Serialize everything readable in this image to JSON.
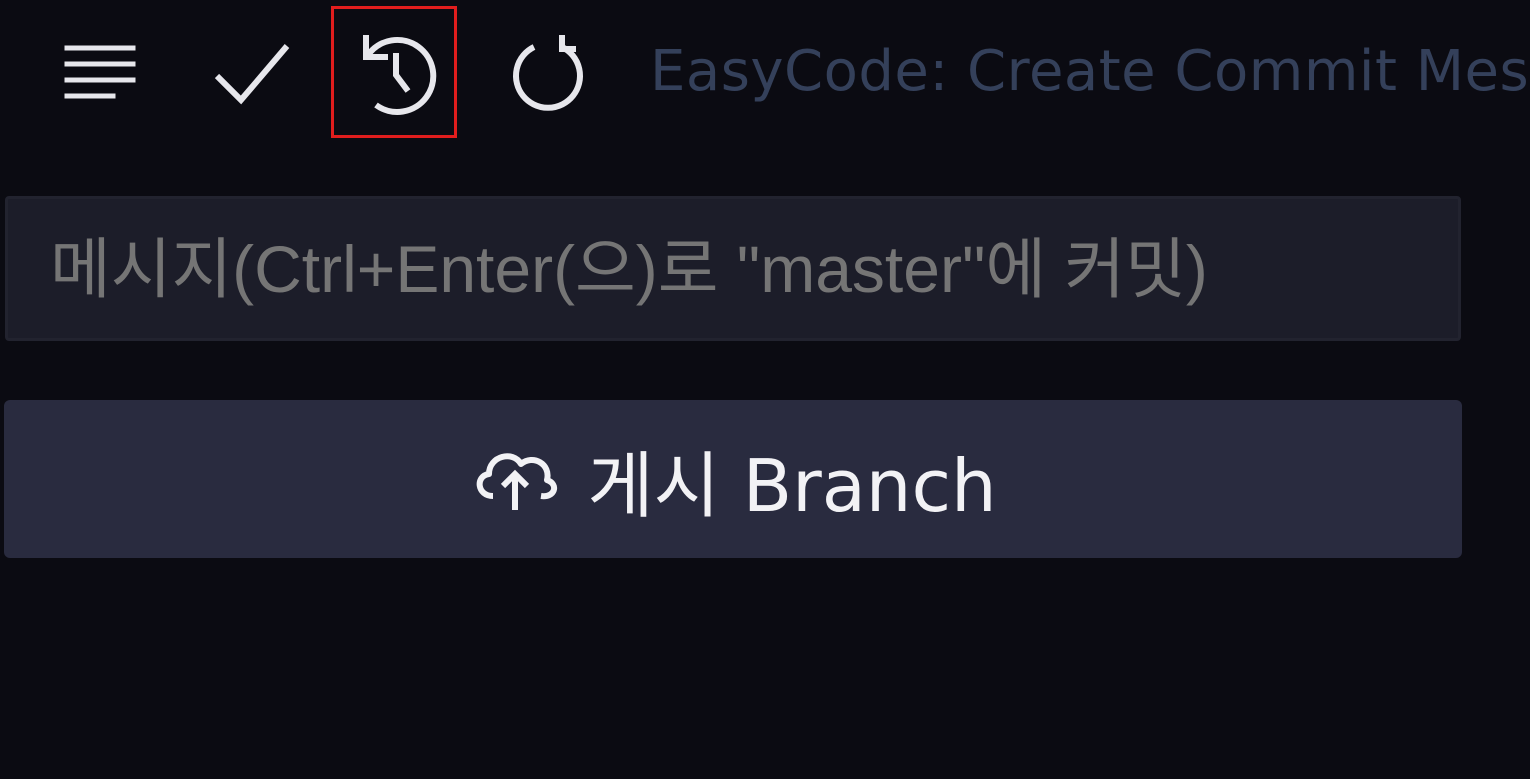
{
  "toolbar": {
    "icons": {
      "menu": "list-flat-icon",
      "commit": "check-icon",
      "undo": "history-undo-icon",
      "refresh": "refresh-icon"
    },
    "title": "EasyCode: Create Commit Mess"
  },
  "commit_message": {
    "value": "",
    "placeholder": "메시지(Ctrl+Enter(으)로 \"master\"에 커밋)"
  },
  "publish_button": {
    "icon": "cloud-upload-icon",
    "label": "게시 Branch"
  },
  "colors": {
    "background": "#0b0b12",
    "highlight_border": "#e11d1d",
    "input_background": "#1c1d29",
    "button_background": "#292b3f",
    "title_text": "#34405a"
  }
}
